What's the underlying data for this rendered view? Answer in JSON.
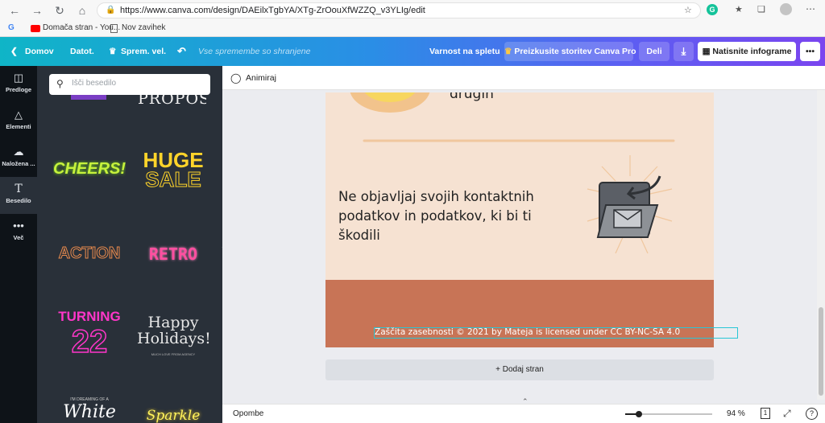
{
  "browser": {
    "url": "https://www.canva.com/design/DAEilxTgbYA/XTg-ZrOouXfWZZQ_v3YLIg/edit",
    "bookmarks": [
      "Domača stran - You...",
      "Nov zavihek"
    ]
  },
  "topbar": {
    "home": "Domov",
    "file": "Datot.",
    "resize": "Sprem. vel.",
    "save_status": "Vse spremembe so shranjene",
    "publish_label": "Varnost na spletu",
    "try_pro": "Preizkusite storitev Canva Pro",
    "share": "Deli",
    "print": "Natisnite infograme",
    "more": "•••"
  },
  "rail": {
    "items": [
      {
        "label": "Predloge",
        "icon": "template-icon"
      },
      {
        "label": "Elementi",
        "icon": "elements-icon"
      },
      {
        "label": "Naložena ...",
        "icon": "upload-icon"
      },
      {
        "label": "Besedilo",
        "icon": "text-icon"
      },
      {
        "label": "Več",
        "icon": "more-dots-icon"
      }
    ]
  },
  "panel": {
    "search_placeholder": "Išči besedilo",
    "tiles": [
      "PROPOSAL",
      "CHEERS!",
      "HUGE",
      "SALE",
      "ACTION",
      "RETRO",
      "TURNING",
      "22",
      "Happy",
      "Holidays!",
      "MUCH LOVE FROM AGENCY",
      "White",
      "Sparkle",
      "I'M DREAMING OF A"
    ]
  },
  "editor": {
    "animate": "Animiraj",
    "page_text_top": "drugih",
    "page_text_main": "Ne objavljaj svojih kontaktnih podatkov in podatkov, ki bi ti škodili",
    "footer_text": "Zaščita zasebnosti © 2021 by Mateja is licensed under CC BY-NC-SA 4.0",
    "add_page": "+ Dodaj stran",
    "notes": "Opombe",
    "zoom": "94 %",
    "page_count": "1",
    "help": "?"
  },
  "colors": {
    "page_bg": "#f6e2d2",
    "footer_band": "#c87456",
    "accent": "#7a45ef"
  }
}
